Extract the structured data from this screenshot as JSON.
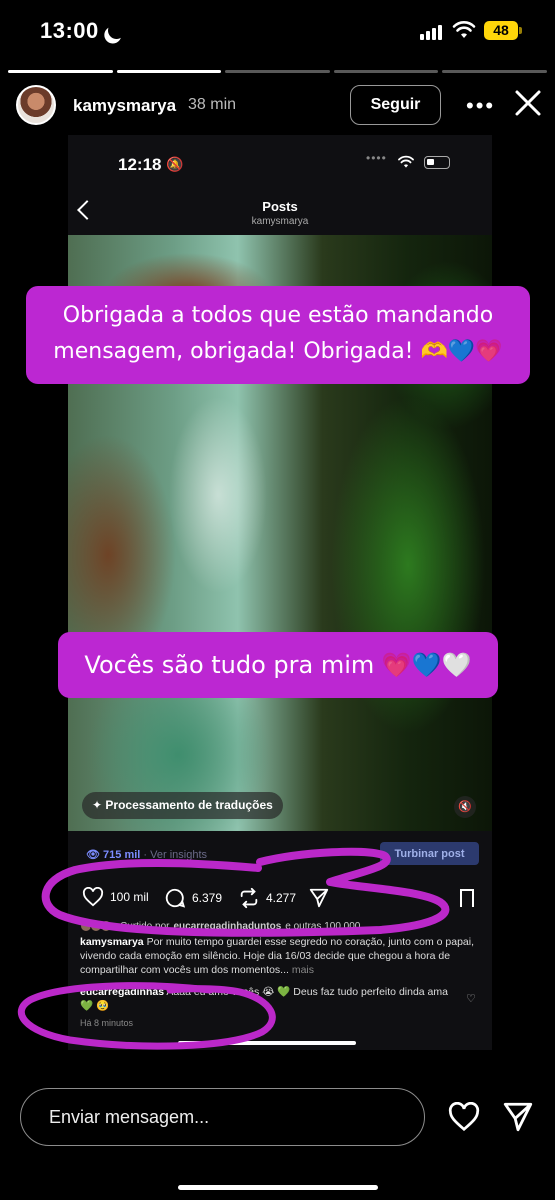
{
  "status_bar": {
    "time": "13:00",
    "battery": "48"
  },
  "story": {
    "progress": [
      1,
      1,
      0,
      0,
      0
    ],
    "username": "kamysmarya",
    "time_ago": "38 min",
    "follow_label": "Seguir",
    "more_label": "•••"
  },
  "inner_screen": {
    "time": "12:18",
    "page_title": "Posts",
    "page_subtitle": "kamysmarya",
    "translation_chip": "Processamento de traduções",
    "views": "715 mil",
    "insights_link": "Ver insights",
    "boost_label": "Turbinar post",
    "likes": "100 mil",
    "comments": "6.379",
    "reposts": "4.277",
    "liked_by_prefix": "Curtido por",
    "liked_by_user": "eucarregadinhaduntos",
    "liked_by_suffix": "e outras 100.000",
    "caption_user": "kamysmarya",
    "caption_text": "Por muito tempo guardei esse segredo no coração, junto com o papai, vivendo cada emoção em silêncio.  Hoje dia 16/03 decide que chegou a hora de compartilhar com vocês um dos momentos...",
    "caption_more": "mais",
    "comment_user": "eucarregadinhas",
    "comment_text": "Aaaa eu amo vocês 😭 💚 Deus faz tudo perfeito dinda  ama 💚 🥹",
    "comment_time": "Há 8 minutos"
  },
  "stickers": {
    "sticker1": "Obrigada a todos que estão mandando mensagem, obrigada! Obrigada! 🫶💙💗",
    "sticker2": "Vocês são tudo pra mim 💗💙🤍"
  },
  "bottom_bar": {
    "message_placeholder": "Enviar mensagem..."
  },
  "colors": {
    "sticker_bg": "#bc27d2",
    "scribble": "#bb28c9",
    "battery": "#ffd60a",
    "link_blue": "#7b8cff"
  }
}
